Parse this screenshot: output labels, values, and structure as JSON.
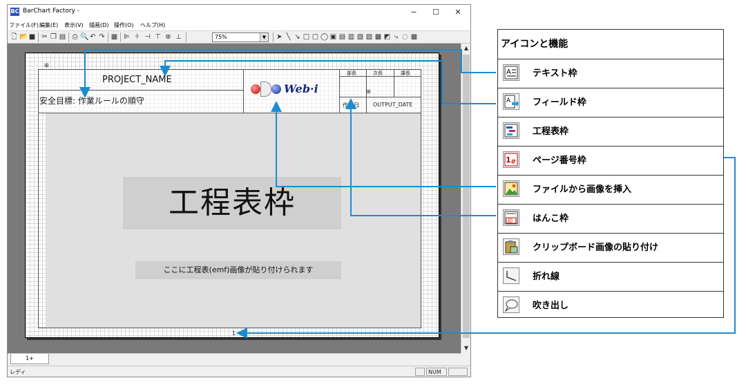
{
  "window": {
    "title": "BarChart Factory -",
    "app_icon": "BC",
    "buttons": {
      "minimize": "−",
      "maximize": "☐",
      "close": "✕"
    }
  },
  "menu": [
    "ファイル(F)",
    "編集(E)",
    "表示(V)",
    "描画(D)",
    "操作(O)",
    "ヘルプ(H)"
  ],
  "toolbar": {
    "zoom_value": "75%",
    "icons": [
      "new-file-icon",
      "open-folder-icon",
      "save-icon",
      "cut-icon",
      "copy-icon",
      "paste-icon",
      "print-icon",
      "print-preview-icon",
      "undo-icon",
      "redo-icon",
      "grid-icon",
      "align-left-icon",
      "align-center-icon",
      "align-right-icon",
      "align-top-icon",
      "align-middle-icon",
      "align-bottom-icon",
      "pointer-icon",
      "line-icon",
      "arrow-line-icon",
      "rectangle-icon",
      "rounded-rectangle-icon",
      "ellipse-icon",
      "text-frame-icon",
      "field-frame-icon",
      "schedule-frame-icon",
      "page-number-frame-icon",
      "insert-image-icon",
      "stamp-frame-icon",
      "clipboard-paste-icon",
      "polyline-icon",
      "balloon-icon",
      "table-icon"
    ]
  },
  "document": {
    "project_name": "PROJECT_NAME",
    "safety_goal": "安全目標: 作業ルールの順守",
    "logo_text": "Web·i",
    "stamp_labels": [
      "部長",
      "次長",
      "課長"
    ],
    "created_label": "作成日",
    "output_date": "OUTPUT_DATE",
    "schedule_frame_label": "工程表枠",
    "schedule_caption": "ここに工程表(emf)画像が貼り付けられます",
    "page_number": "1"
  },
  "tabs": [
    "1+"
  ],
  "status": {
    "text": "レディ",
    "num": "NUM"
  },
  "legend": {
    "title": "アイコンと機能",
    "items": [
      {
        "icon": "text-frame-icon",
        "label": "テキスト枠"
      },
      {
        "icon": "field-frame-icon",
        "label": "フィールド枠"
      },
      {
        "icon": "schedule-frame-icon",
        "label": "工程表枠"
      },
      {
        "icon": "page-number-frame-icon",
        "label": "ページ番号枠"
      },
      {
        "icon": "insert-image-icon",
        "label": "ファイルから画像を挿入"
      },
      {
        "icon": "stamp-frame-icon",
        "label": "はんこ枠"
      },
      {
        "icon": "clipboard-paste-icon",
        "label": "クリップボード画像の貼り付け"
      },
      {
        "icon": "polyline-icon",
        "label": "折れ線"
      },
      {
        "icon": "balloon-icon",
        "label": "吹き出し"
      }
    ]
  },
  "colors": {
    "callout": "#1a8cd0",
    "canvas_bg": "#7a7a7a",
    "schedule_area": "#e0e0e0"
  }
}
